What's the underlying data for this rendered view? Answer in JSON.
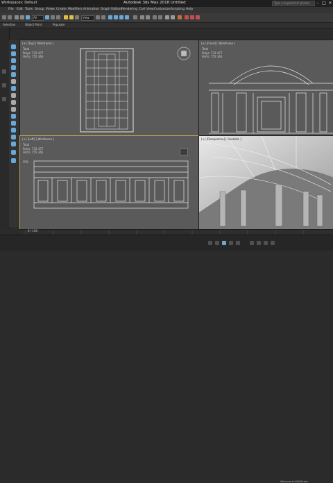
{
  "titlebar": {
    "workspace": "Workspaces: Default",
    "app_title": "Autodesk 3ds Max 2018  Untitled",
    "search_placeholder": "Type a keyword or phrase",
    "minimize": "–",
    "maximize": "□",
    "close": "✕"
  },
  "menubar": {
    "items": [
      "File",
      "Edit",
      "Tools",
      "Group",
      "Views",
      "Create",
      "Modifiers",
      "Animation",
      "Graph Editors",
      "Rendering",
      "Civil View",
      "Customize",
      "Scripting",
      "Help"
    ]
  },
  "toolbar": {
    "selection_filter": "All",
    "view_dropdown": "View"
  },
  "ribbon": {
    "tabs": [
      "Selection",
      "Object Paint",
      "Populate"
    ]
  },
  "viewports": {
    "top": {
      "label": "[+] [Top] [ Wireframe ]"
    },
    "front": {
      "label": "[+] [Front] [ Wireframe ]"
    },
    "left": {
      "label": "[+] [Left] [ Wireframe ]"
    },
    "persp": {
      "label": "[+] [Perspective] [ Realistic ]"
    },
    "stats": {
      "total": "Total",
      "polys_label": "Polys:",
      "polys_value": "732 477",
      "verts_label": "Verts:",
      "verts_value": "755 346",
      "fps": "FPS:"
    }
  },
  "timeline": {
    "frame": "0 / 100"
  },
  "status": {
    "welcome": "Welcome to MAXScript."
  },
  "colors": {
    "accent": "#6aa8d8",
    "viewport_bg": "#5a5a5a",
    "active_border": "#c8a24a"
  }
}
